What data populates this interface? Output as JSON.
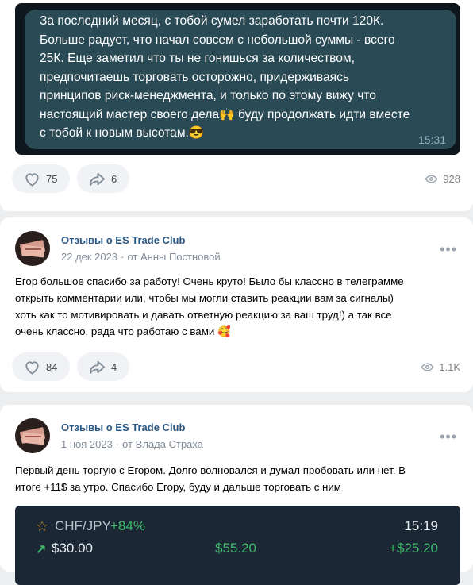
{
  "posts": [
    {
      "image_text_lines": [
        "За последний месяц, с тобой сумел заработать почти 120К.",
        "Больше радует, что начал совсем с небольшой суммы - всего",
        "25К. Еще заметил что ты не гонишься за количеством,",
        "предпочитаешь торговать осторожно, придерживаясь",
        "принципов риск-менеджмента, и только по этому вижу что",
        "настоящий мастер своего дела🙌 буду продолжать идти вместе",
        "с тобой к новым высотам.😎"
      ],
      "image_time": "15:31",
      "likes": "75",
      "shares": "6",
      "views": "928"
    },
    {
      "group": "Отзывы о ES Trade Club",
      "date": "22 дек 2023",
      "author": "от Анны Постновой",
      "text_lines": [
        "Егор большое спасибо за работу! Очень круто! Было бы классно в телеграмме",
        "открыть комментарии или, чтобы мы могли ставить реакции вам за сигналы)",
        "хоть как то мотивировать и давать ответную реакцию за ваш труд!) а так все",
        "очень классно, рада что работаю с вами 🥰"
      ],
      "likes": "84",
      "shares": "4",
      "views": "1.1K"
    },
    {
      "group": "Отзывы о ES Trade Club",
      "date": "1 ноя 2023",
      "author": "от Влада Страха",
      "text_lines": [
        "Первый день торгую с Егором. Долго волновался и думал пробовать или нет. В",
        "итоге +11$ за утро. Спасибо Егору, буду и дальше торговать с ним"
      ],
      "trade": {
        "pair": "CHF/JPY",
        "percent": "+84%",
        "time": "15:19",
        "amount": "$30.00",
        "payout": "$55.20",
        "profit": "+$25.20"
      }
    }
  ],
  "separator": "·",
  "more": "•••",
  "icons": {
    "like": "heart-icon",
    "share": "share-arrow-icon",
    "views": "eye-icon",
    "star": "star-icon",
    "arrow": "arrow-up-right-icon"
  }
}
